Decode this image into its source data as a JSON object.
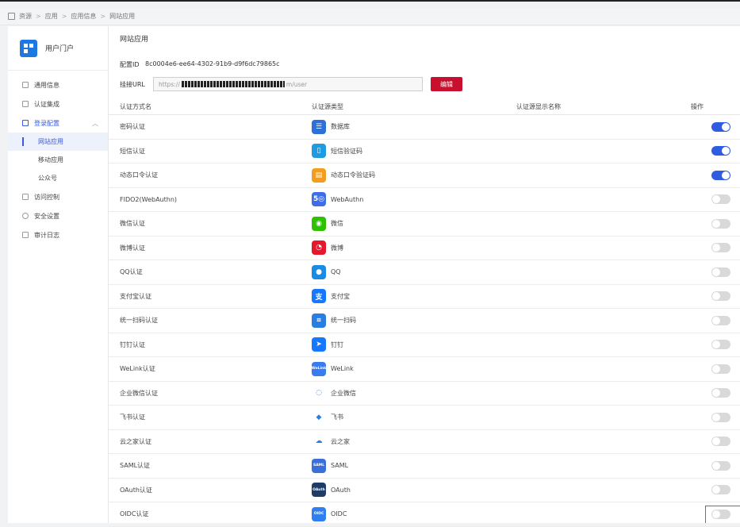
{
  "breadcrumb": [
    "资源",
    "应用",
    "应用信息",
    "网站应用"
  ],
  "app": {
    "name": "用户门户",
    "accent": "#1f77e0"
  },
  "sidebar": {
    "items": [
      {
        "label": "通用信息",
        "icon": "info-doc-icon"
      },
      {
        "label": "认证集成",
        "icon": "list-icon"
      },
      {
        "label": "登录配置",
        "icon": "login-icon",
        "open": true,
        "children": [
          {
            "label": "网站应用",
            "active": true
          },
          {
            "label": "移动应用"
          },
          {
            "label": "公众号"
          }
        ]
      },
      {
        "label": "访问控制",
        "icon": "access-icon"
      },
      {
        "label": "安全设置",
        "icon": "shield-icon"
      },
      {
        "label": "审计日志",
        "icon": "log-icon"
      }
    ]
  },
  "main": {
    "title": "网站应用",
    "config_id_label": "配置ID",
    "config_id": "8c0004e6-ee64-4302-91b9-d9f6dc79865c",
    "url_label": "挂接URL",
    "url_prefix": "https://",
    "url_suffix": "m/user",
    "edit_label": "编辑",
    "columns": [
      "认证方式名",
      "认证源类型",
      "认证源显示名称",
      "操作"
    ],
    "rows": [
      {
        "method": "密码认证",
        "source": "数据库",
        "icon": "database-icon",
        "color": "#2f6fd8",
        "glyph": "☰",
        "on": true
      },
      {
        "method": "短信认证",
        "source": "短信验证码",
        "icon": "sms-icon",
        "color": "#1f9be0",
        "glyph": "▯",
        "on": true
      },
      {
        "method": "动态口令认证",
        "source": "动态口令验证码",
        "icon": "otp-icon",
        "color": "#f39c1f",
        "glyph": "▤",
        "on": true
      },
      {
        "method": "FIDO2(WebAuthn)",
        "source": "WebAuthn",
        "icon": "webauthn-icon",
        "color": "#3f6de8",
        "glyph": "5◎",
        "on": false
      },
      {
        "method": "微信认证",
        "source": "微信",
        "icon": "wechat-icon",
        "color": "#2dc100",
        "glyph": "◉",
        "on": false
      },
      {
        "method": "微博认证",
        "source": "微博",
        "icon": "weibo-icon",
        "color": "#e6162d",
        "glyph": "◔",
        "on": false
      },
      {
        "method": "QQ认证",
        "source": "QQ",
        "icon": "qq-icon",
        "color": "#1a8ce3",
        "glyph": "●",
        "on": false
      },
      {
        "method": "支付宝认证",
        "source": "支付宝",
        "icon": "alipay-icon",
        "color": "#1677ff",
        "glyph": "支",
        "on": false
      },
      {
        "method": "统一扫码认证",
        "source": "统一扫码",
        "icon": "scan-icon",
        "color": "#2a7de1",
        "glyph": "⌗",
        "on": false
      },
      {
        "method": "钉钉认证",
        "source": "钉钉",
        "icon": "dingtalk-icon",
        "color": "#1677ff",
        "glyph": "➤",
        "on": false
      },
      {
        "method": "WeLink认证",
        "source": "WeLink",
        "icon": "welink-icon",
        "color": "#3a7bf0",
        "glyph": "WeLink",
        "on": false
      },
      {
        "method": "企业微信认证",
        "source": "企业微信",
        "icon": "wecom-icon",
        "color": "#ffffff",
        "glyph": "◌",
        "on": false
      },
      {
        "method": "飞书认证",
        "source": "飞书",
        "icon": "feishu-icon",
        "color": "#ffffff",
        "glyph": "◆",
        "on": false
      },
      {
        "method": "云之家认证",
        "source": "云之家",
        "icon": "yunzhijia-icon",
        "color": "#ffffff",
        "glyph": "☁",
        "on": false
      },
      {
        "method": "SAML认证",
        "source": "SAML",
        "icon": "saml-icon",
        "color": "#3a6fd8",
        "glyph": "SAML",
        "on": false
      },
      {
        "method": "OAuth认证",
        "source": "OAuth",
        "icon": "oauth-icon",
        "color": "#1f3c66",
        "glyph": "OAuth",
        "on": false
      },
      {
        "method": "OIDC认证",
        "source": "OIDC",
        "icon": "oidc-icon",
        "color": "#2f7ff0",
        "glyph": "OIDC",
        "on": false
      }
    ]
  }
}
